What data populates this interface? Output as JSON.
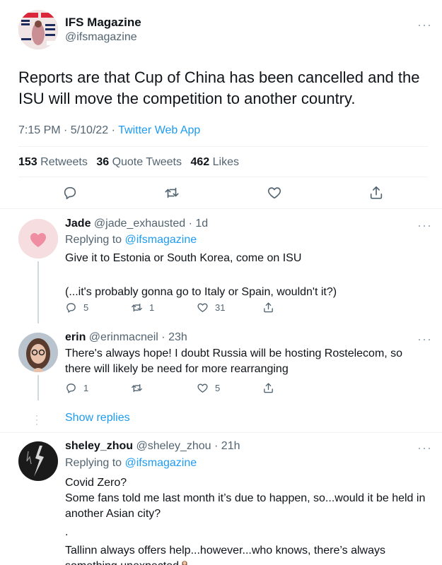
{
  "main_tweet": {
    "author_name": "IFS Magazine",
    "author_handle": "@ifsmagazine",
    "text": "Reports are that Cup of China has been cancelled and the ISU will move the competition to another country.",
    "time": "7:15 PM · 5/10/22 · ",
    "source": "Twitter Web App",
    "retweets_count": "153",
    "retweets_label": "Retweets",
    "quotes_count": "36",
    "quotes_label": "Quote Tweets",
    "likes_count": "462",
    "likes_label": "Likes"
  },
  "replies": [
    {
      "name": "Jade",
      "handle_time": "@jade_exhausted · 1d",
      "replying_prefix": "Replying to ",
      "replying_to": "@ifsmagazine",
      "lines": [
        "Give it to Estonia or South Korea, come on ISU",
        "",
        "(...it's probably gonna go to Italy or Spain, wouldn't it?)"
      ],
      "reply_count": "5",
      "retweet_count": "1",
      "like_count": "31"
    },
    {
      "name": "erin",
      "handle_time": "@erinmacneil · 23h",
      "lines": [
        "There's always hope! I doubt Russia will be hosting Rostelecom, so there will likely be need for more rearranging"
      ],
      "reply_count": "1",
      "retweet_count": "",
      "like_count": "5"
    },
    {
      "name": "sheley_zhou",
      "handle_time": "@sheley_zhou · 21h",
      "replying_prefix": "Replying to ",
      "replying_to": "@ifsmagazine",
      "lines": [
        "Covid Zero?",
        "Some fans told me last month it’s due to happen, so...would it be held in another Asian city?",
        ".",
        "Tallinn always offers help...however...who knows, there’s always something unexpected"
      ]
    }
  ],
  "show_replies": "Show replies",
  "icons": [
    "reply-icon",
    "retweet-icon",
    "like-icon",
    "share-icon",
    "more-icon",
    "woman-shrugging-emoji"
  ],
  "colors": {
    "link": "#1d9bf0",
    "secondary_text": "#536471",
    "divider": "#eff3f4"
  }
}
